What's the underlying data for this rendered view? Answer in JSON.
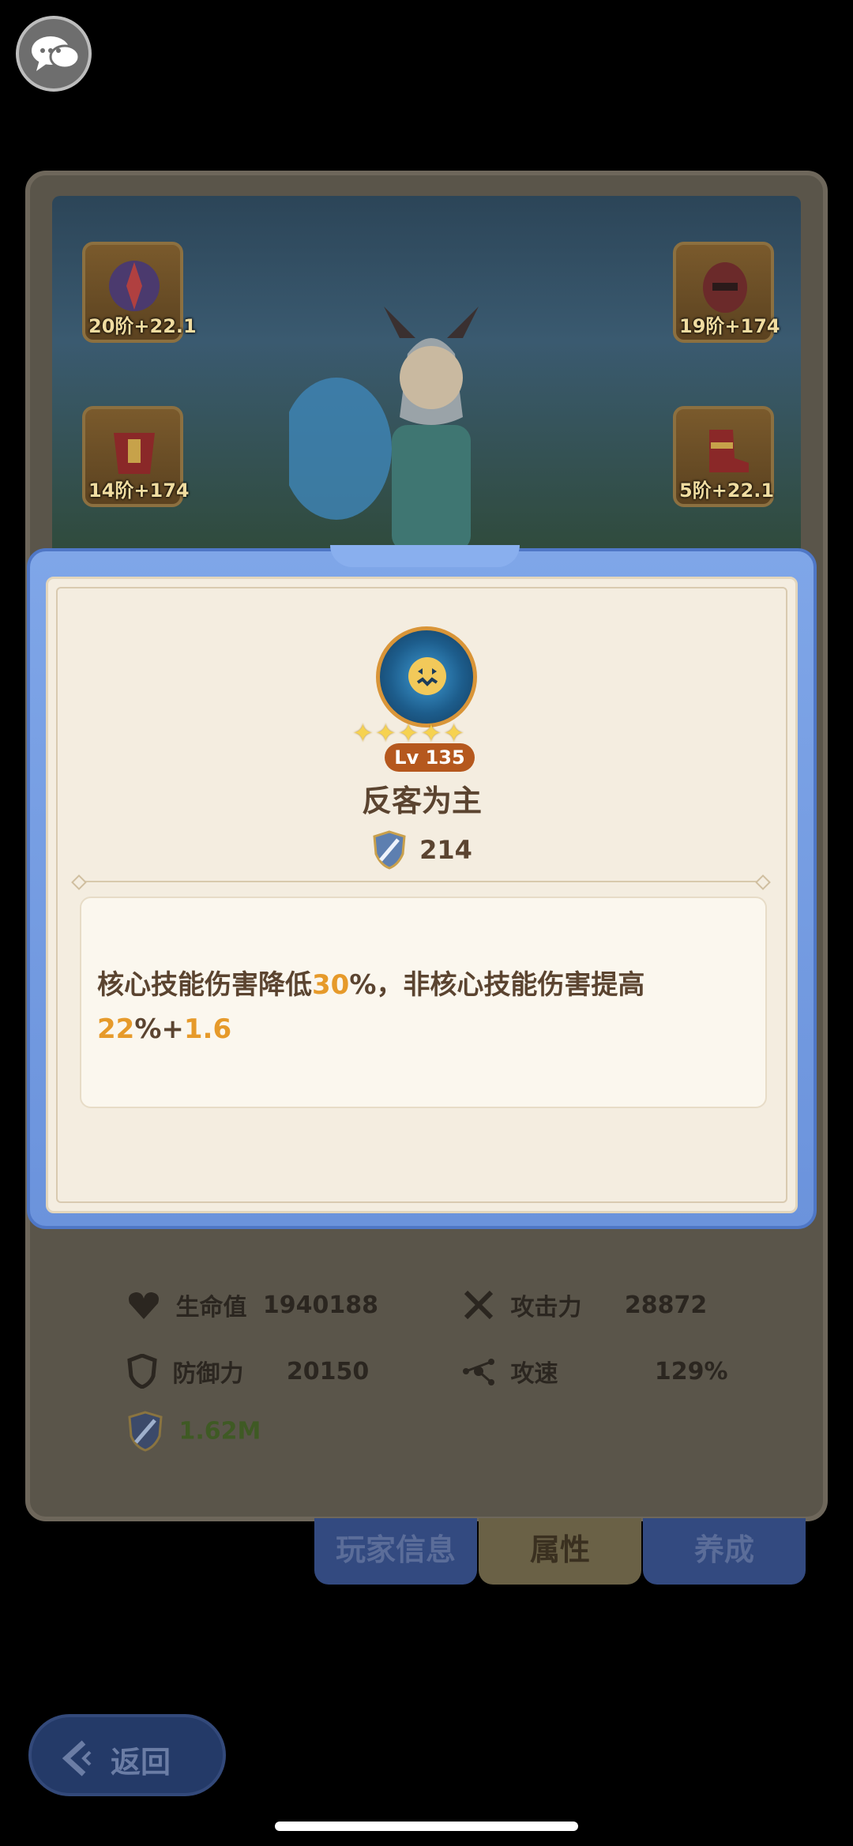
{
  "equipment": [
    {
      "label": "20阶+22.1"
    },
    {
      "label": "19阶+174"
    },
    {
      "label": "14阶+174"
    },
    {
      "label": "5阶+22.1"
    }
  ],
  "skill": {
    "stars": 5,
    "level": "Lv 135",
    "name": "反客为主",
    "power": "214",
    "desc_part1": "核心技能伤害降低",
    "desc_val1": "30",
    "desc_part2": "%，非核心技能伤害提高",
    "desc_val2": "22",
    "desc_part3": "%+",
    "desc_val3": "1.6"
  },
  "attributes": {
    "header": "属性",
    "hp_label": "生命值",
    "hp_value": "1940188",
    "atk_label": "攻击力",
    "atk_value": "28872",
    "def_label": "防御力",
    "def_value": "20150",
    "spd_label": "攻速",
    "spd_value": "129%",
    "power_value": "1.62M"
  },
  "tabs": {
    "player": "玩家信息",
    "attr": "属性",
    "train": "养成"
  },
  "back_label": "返回",
  "colors": {
    "highlight": "#e69a2a",
    "modal_border": "#6b93dc",
    "modal_bg": "#f4ede0"
  }
}
